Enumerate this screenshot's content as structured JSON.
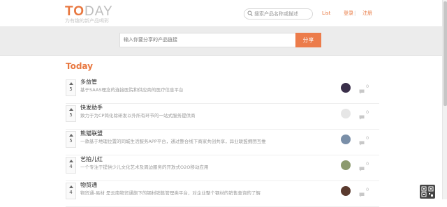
{
  "header": {
    "logo_to": "TO",
    "logo_day": "DAY",
    "logo_subtitle": "为有趣的新产品喝彩",
    "search_placeholder": "搜索产品名称或描述",
    "nav": {
      "list": "List",
      "login": "登录",
      "separator": "|",
      "register": "注册"
    }
  },
  "share": {
    "placeholder": "输入你要分享的产品链接",
    "button": "分享"
  },
  "section_title": "Today",
  "products": [
    {
      "title": "多益管",
      "desc": "基于SAAS理念的连接医院和供应商的医疗信息平台",
      "votes": "5",
      "comments": "0",
      "avatar_color": "#3a2f4a"
    },
    {
      "title": "快发助手",
      "desc": "致力于为CP简化除研发以外所有环节的一站式服务提供商",
      "votes": "5",
      "comments": "0",
      "avatar_color": "#e6e6e6"
    },
    {
      "title": "熊猫联盟",
      "desc": "一款基于地理位置的同城生活服务APP平台，通过整合线下商家共创共享，异业联盟拥团互推",
      "votes": "5",
      "comments": "0",
      "avatar_color": "#7a8fa8"
    },
    {
      "title": "艺拍儿红",
      "desc": "一个专注于提供少儿文化艺术及周边服务的开放式O2O移动应用",
      "votes": "4",
      "comments": "0",
      "avatar_color": "#8c9a6e"
    },
    {
      "title": "物贸通",
      "desc": "物贸通-易材 是云南物贸通旗下的钢材销售管理类平台，对企业整个钢材的销售查询的了解",
      "votes": "4",
      "comments": "0",
      "avatar_color": "#5a3a2e"
    }
  ],
  "colors": {
    "accent": "#e8773f",
    "share_button": "#ec7c4b"
  }
}
